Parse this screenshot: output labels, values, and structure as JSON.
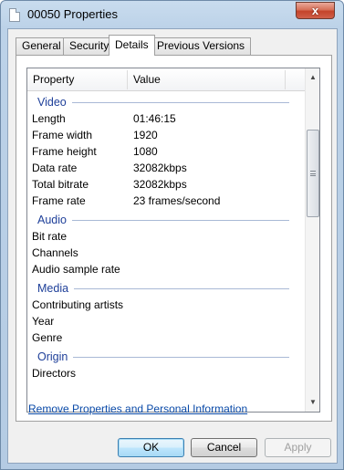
{
  "window": {
    "title": "00050 Properties",
    "close_glyph": "x"
  },
  "tabs": [
    {
      "label": "General",
      "active": false
    },
    {
      "label": "Security",
      "active": false
    },
    {
      "label": "Details",
      "active": true
    },
    {
      "label": "Previous Versions",
      "active": false
    }
  ],
  "list": {
    "headers": {
      "property": "Property",
      "value": "Value"
    },
    "groups": [
      {
        "name": "Video",
        "rows": [
          {
            "property": "Length",
            "value": "01:46:15"
          },
          {
            "property": "Frame width",
            "value": "1920"
          },
          {
            "property": "Frame height",
            "value": "1080"
          },
          {
            "property": "Data rate",
            "value": "32082kbps"
          },
          {
            "property": "Total bitrate",
            "value": "32082kbps"
          },
          {
            "property": "Frame rate",
            "value": "23 frames/second"
          }
        ]
      },
      {
        "name": "Audio",
        "rows": [
          {
            "property": "Bit rate",
            "value": ""
          },
          {
            "property": "Channels",
            "value": ""
          },
          {
            "property": "Audio sample rate",
            "value": ""
          }
        ]
      },
      {
        "name": "Media",
        "rows": [
          {
            "property": "Contributing artists",
            "value": ""
          },
          {
            "property": "Year",
            "value": ""
          },
          {
            "property": "Genre",
            "value": ""
          }
        ]
      },
      {
        "name": "Origin",
        "rows": [
          {
            "property": "Directors",
            "value": ""
          }
        ]
      }
    ],
    "scroll_position": 0.2
  },
  "link": {
    "label": "Remove Properties and Personal Information"
  },
  "buttons": {
    "ok": "OK",
    "cancel": "Cancel",
    "apply": "Apply"
  },
  "icons": {
    "title": "file-icon",
    "scroll_up": "arrow-up-icon",
    "scroll_down": "arrow-down-icon"
  }
}
